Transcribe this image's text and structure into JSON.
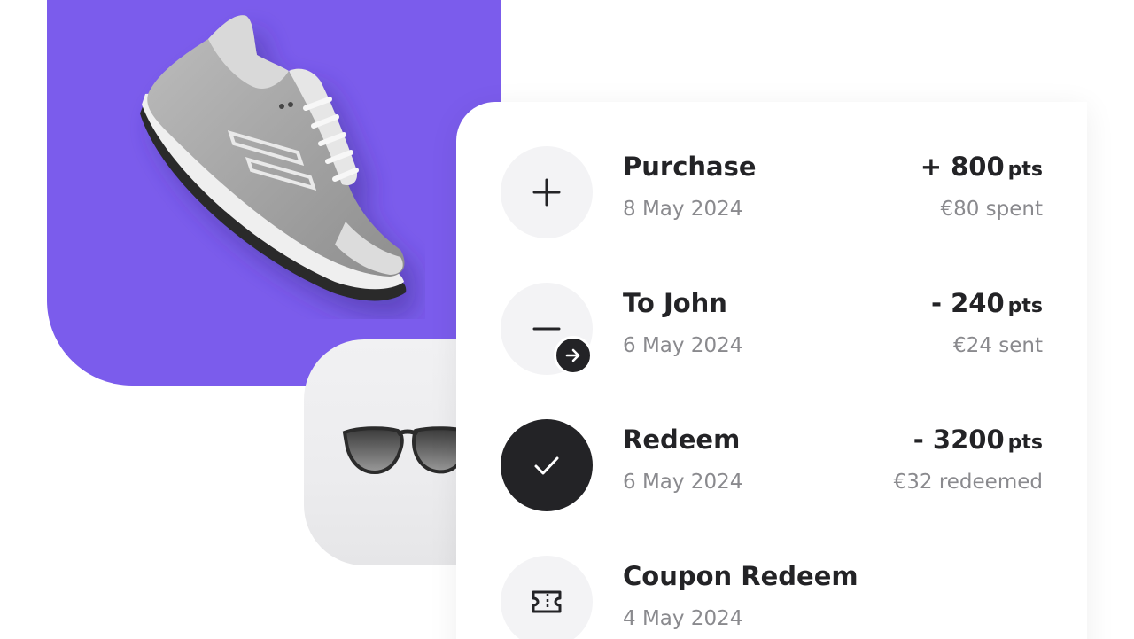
{
  "products": {
    "shoe_image": "sneaker",
    "glasses_image": "sunglasses",
    "accent_color": "#7b5cec"
  },
  "transactions": [
    {
      "icon": "plus-icon",
      "title": "Purchase",
      "date": "8 May 2024",
      "amount": "+ 800",
      "unit": "pts",
      "subtext": "€80 spent"
    },
    {
      "icon": "minus-transfer-icon",
      "title": "To John",
      "date": "6 May 2024",
      "amount": "- 240",
      "unit": "pts",
      "subtext": "€24 sent"
    },
    {
      "icon": "check-icon",
      "title": "Redeem",
      "date": "6 May 2024",
      "amount": "- 3200",
      "unit": "pts",
      "subtext": "€32 redeemed"
    },
    {
      "icon": "ticket-icon",
      "title": "Coupon Redeem",
      "date": "4 May 2024"
    }
  ]
}
